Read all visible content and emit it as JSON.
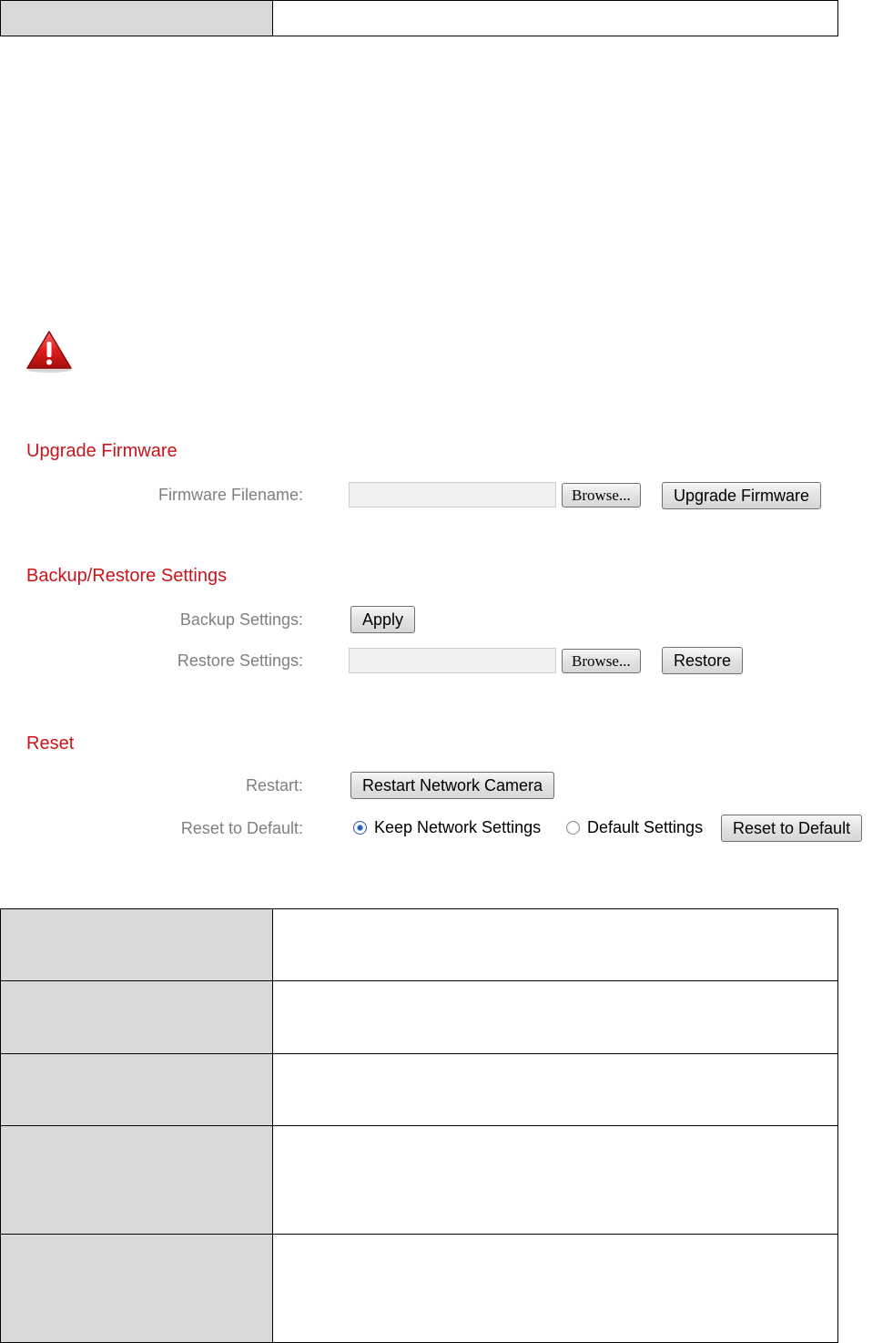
{
  "upgrade": {
    "title": "Upgrade Firmware",
    "filename_label": "Firmware Filename:",
    "browse_label": "Browse...",
    "upgrade_button": "Upgrade Firmware"
  },
  "backup": {
    "title": "Backup/Restore Settings",
    "backup_label": "Backup Settings:",
    "apply_button": "Apply",
    "restore_label": "Restore Settings:",
    "browse_label": "Browse...",
    "restore_button": "Restore"
  },
  "reset": {
    "title": "Reset",
    "restart_label": "Restart:",
    "restart_button": "Restart Network Camera",
    "default_label": "Reset to Default:",
    "option_keep": "Keep Network Settings",
    "option_default": "Default Settings",
    "selected_option": "Keep Network Settings",
    "reset_button": "Reset to Default"
  },
  "icons": {
    "warning": "warning-triangle-icon",
    "accent_color": "#c8151b"
  }
}
